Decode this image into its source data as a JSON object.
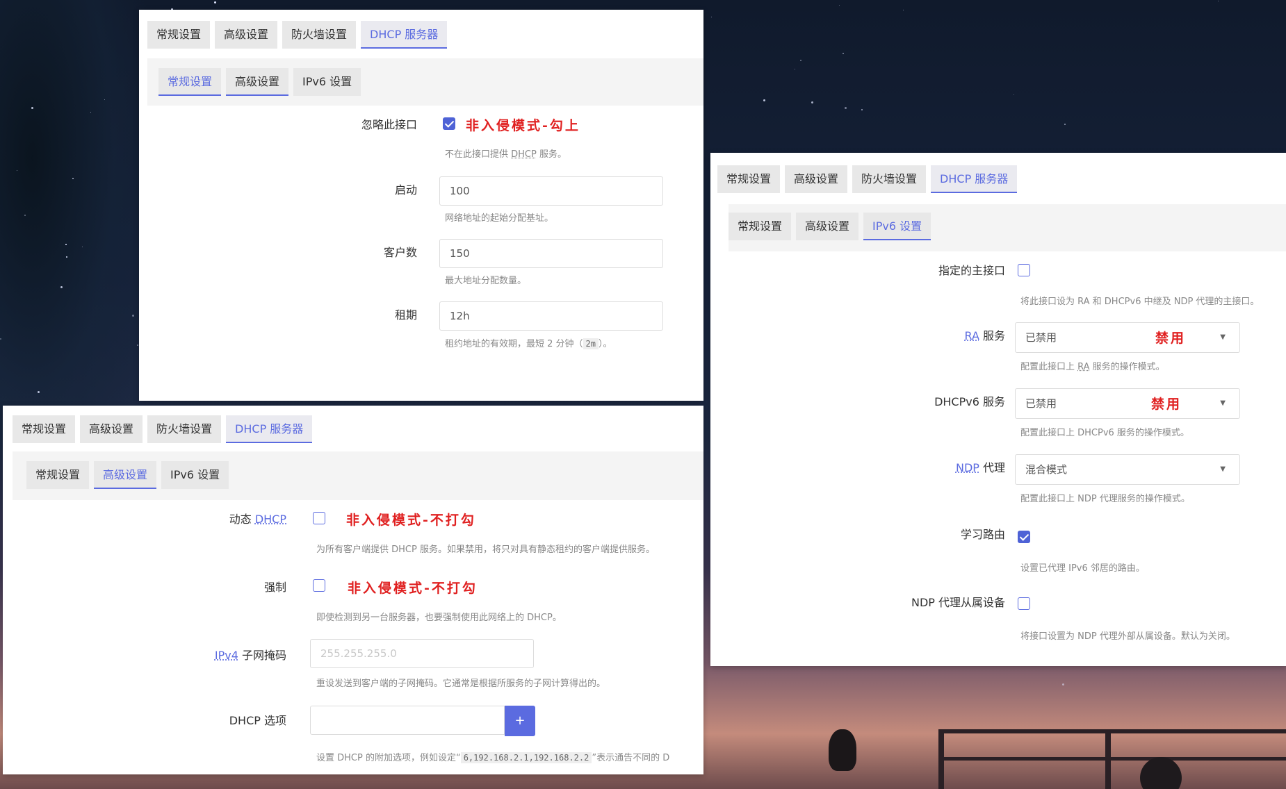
{
  "top_tabs": [
    "常规设置",
    "高级设置",
    "防火墙设置",
    "DHCP 服务器"
  ],
  "sub_tabs": [
    "常规设置",
    "高级设置",
    "IPv6 设置"
  ],
  "panel_general": {
    "ignore_label": "忽略此接口",
    "ignore_annotation": "非入侵模式-勾上",
    "ignore_hint_prefix": "不在此接口提供 ",
    "ignore_hint_abbr": "DHCP",
    "ignore_hint_suffix": " 服务。",
    "start_label": "启动",
    "start_value": "100",
    "start_hint": "网络地址的起始分配基址。",
    "clients_label": "客户数",
    "clients_value": "150",
    "clients_hint": "最大地址分配数量。",
    "lease_label": "租期",
    "lease_value": "12h",
    "lease_hint_prefix": "租约地址的有效期，最短 2 分钟（",
    "lease_hint_code": "2m",
    "lease_hint_suffix": "）。"
  },
  "panel_advanced": {
    "dynamic_label_prefix": "动态 ",
    "dynamic_label_abbr": "DHCP",
    "dynamic_annotation": "非入侵模式-不打勾",
    "dynamic_hint": "为所有客户端提供 DHCP 服务。如果禁用，将只对具有静态租约的客户端提供服务。",
    "force_label": "强制",
    "force_annotation": "非入侵模式-不打勾",
    "force_hint": "即使检测到另一台服务器，也要强制使用此网络上的 DHCP。",
    "netmask_label_abbr": "IPv4",
    "netmask_label_suffix": " 子网掩码",
    "netmask_placeholder": "255.255.255.0",
    "netmask_hint": "重设发送到客户端的子网掩码。它通常是根据所服务的子网计算得出的。",
    "options_label": "DHCP 选项",
    "options_add": "+",
    "options_hint_prefix": "设置 DHCP 的附加选项，例如设定“",
    "options_hint_code": "6,192.168.2.1,192.168.2.2",
    "options_hint_suffix": "”表示通告不同的 D"
  },
  "panel_ipv6": {
    "master_label": "指定的主接口",
    "master_hint": "将此接口设为 RA 和 DHCPv6 中继及 NDP 代理的主接口。",
    "ra_label_abbr": "RA",
    "ra_label_suffix": " 服务",
    "ra_value": "已禁用",
    "ra_annotation": "禁用",
    "ra_hint_prefix": "配置此接口上 ",
    "ra_hint_abbr": "RA",
    "ra_hint_suffix": " 服务的操作模式。",
    "dhcpv6_label": "DHCPv6 服务",
    "dhcpv6_value": "已禁用",
    "dhcpv6_annotation": "禁用",
    "dhcpv6_hint": "配置此接口上 DHCPv6 服务的操作模式。",
    "ndp_label_abbr": "NDP",
    "ndp_label_suffix": " 代理",
    "ndp_value": "混合模式",
    "ndp_hint": "配置此接口上 NDP 代理服务的操作模式。",
    "learn_label": "学习路由",
    "learn_hint": "设置已代理 IPv6 邻居的路由。",
    "slave_label": "NDP 代理从属设备",
    "slave_hint": "将接口设置为 NDP 代理外部从属设备。默认为关闭。"
  }
}
